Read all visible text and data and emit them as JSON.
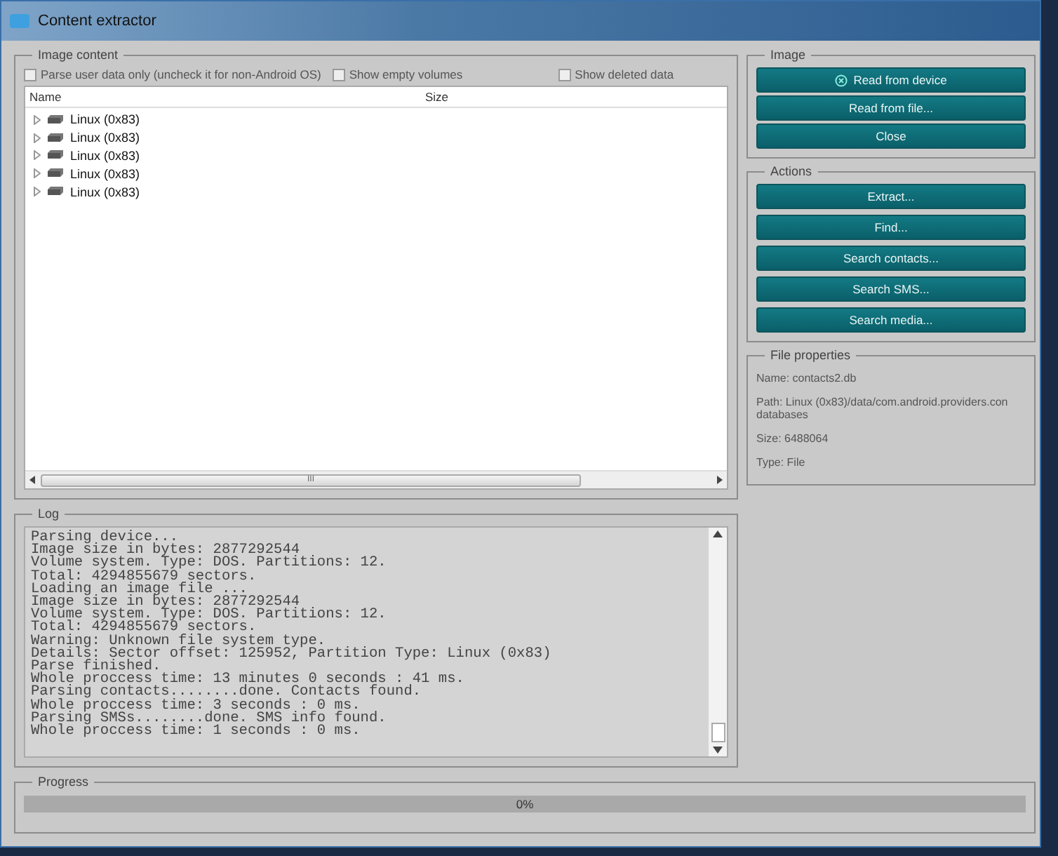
{
  "window": {
    "title": "Content extractor"
  },
  "image_content": {
    "title": "Image content",
    "options": [
      {
        "label": "Parse user data only (uncheck it for non-Android OS)",
        "checked": false
      },
      {
        "label": "Show empty volumes",
        "checked": false
      },
      {
        "label": "Show deleted data",
        "checked": false
      }
    ],
    "columns": [
      "Name",
      "Size"
    ],
    "tree": [
      {
        "label": "Linux (0x83)",
        "expanded": false
      },
      {
        "label": "Linux (0x83)",
        "expanded": false
      },
      {
        "label": "Linux (0x83)",
        "expanded": false
      },
      {
        "label": "Linux (0x83)",
        "expanded": false
      },
      {
        "label": "Linux (0x83)",
        "expanded": false
      }
    ],
    "scroll_grip": "III"
  },
  "image": {
    "title": "Image",
    "buttons": [
      {
        "label": "Read from device",
        "kind": "icon"
      },
      {
        "label": "Read from file...",
        "kind": "plain"
      },
      {
        "label": "Close",
        "kind": "plain"
      }
    ]
  },
  "actions": {
    "title": "Actions",
    "buttons": [
      "Extract...",
      "Find...",
      "Search contacts...",
      "Search SMS...",
      "Search media..."
    ]
  },
  "file_properties": {
    "title": "File properties",
    "lines": [
      "Name: contacts2.db",
      "Path: Linux (0x83)/data/com.android.providers.con\ndatabases",
      "Size: 6488064",
      "Type: File"
    ]
  },
  "log": {
    "title": "Log",
    "lines": [
      "Parsing device...",
      "Image size in bytes: 2877292544",
      "Volume system. Type: DOS. Partitions: 12.",
      "Total: 4294855679 sectors.",
      "Loading an image file ...",
      "Image size in bytes: 2877292544",
      "Volume system. Type: DOS. Partitions: 12.",
      "Total: 4294855679 sectors.",
      "Warning: Unknown file system type.",
      "Details: Sector offset: 125952, Partition Type: Linux (0x83)",
      "Parse finished.",
      "Whole proccess time: 13 minutes 0 seconds : 41 ms.",
      "Parsing contacts........done. Contacts found.",
      "Whole proccess time: 3 seconds : 0 ms.",
      "Parsing SMSs........done. SMS info found.",
      "Whole proccess time: 1 seconds : 0 ms."
    ]
  },
  "progress": {
    "title": "Progress",
    "level": 0,
    "reading": "0%"
  }
}
